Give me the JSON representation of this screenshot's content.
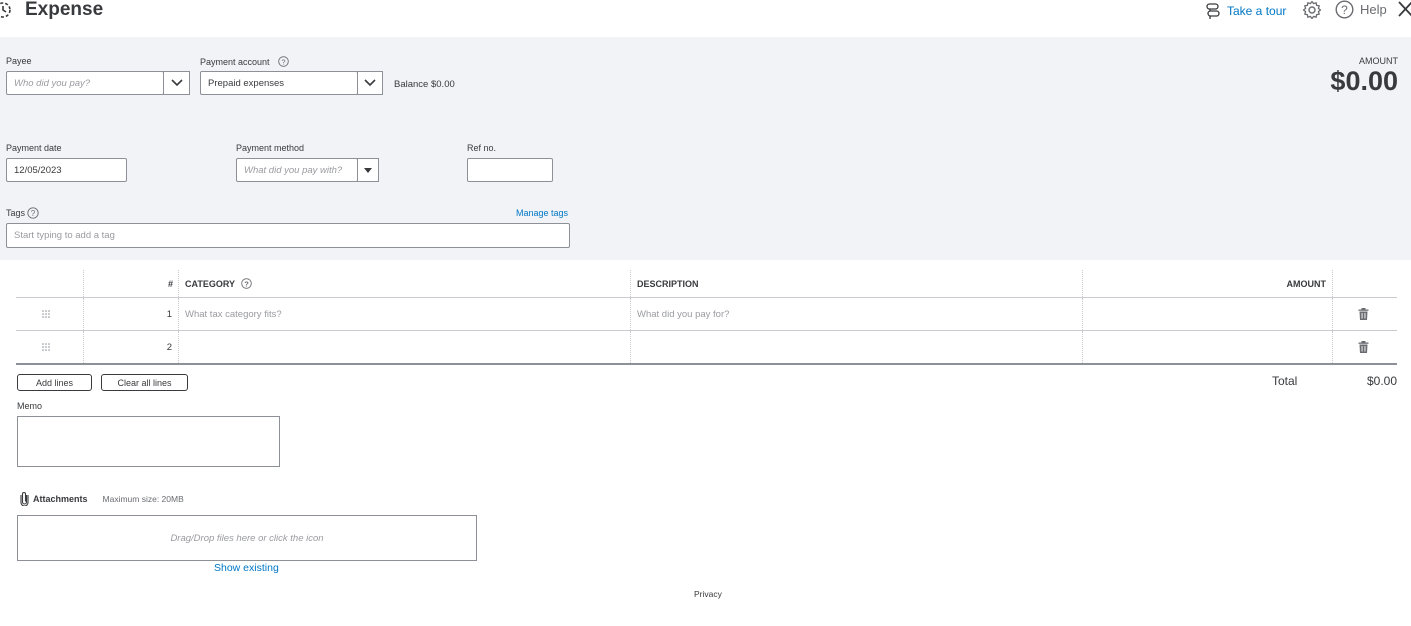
{
  "header": {
    "title": "Expense",
    "tour_label": "Take a tour",
    "help_label": "Help"
  },
  "form": {
    "payee_label": "Payee",
    "payee_placeholder": "Who did you pay?",
    "payment_account_label": "Payment account",
    "payment_account_value": "Prepaid expenses",
    "balance_label": "Balance",
    "balance_value": "$0.00",
    "amount_label": "AMOUNT",
    "amount_value": "$0.00",
    "payment_date_label": "Payment date",
    "payment_date_value": "12/05/2023",
    "payment_method_label": "Payment method",
    "payment_method_placeholder": "What did you pay with?",
    "ref_label": "Ref no.",
    "ref_value": "",
    "tags_label": "Tags",
    "manage_tags_label": "Manage tags",
    "tags_placeholder": "Start typing to add a tag"
  },
  "table": {
    "headers": {
      "num": "#",
      "category": "CATEGORY",
      "description": "DESCRIPTION",
      "amount": "AMOUNT"
    },
    "rows": [
      {
        "num": "1",
        "category_placeholder": "What tax category fits?",
        "description_placeholder": "What did you pay for?",
        "amount": ""
      },
      {
        "num": "2",
        "category_placeholder": "",
        "description_placeholder": "",
        "amount": ""
      }
    ],
    "add_lines_label": "Add lines",
    "clear_lines_label": "Clear all lines",
    "total_label": "Total",
    "total_value": "$0.00"
  },
  "memo": {
    "label": "Memo",
    "value": ""
  },
  "attachments": {
    "label": "Attachments",
    "max_size": "Maximum size: 20MB",
    "drop_text": "Drag/Drop files here or click the icon",
    "show_existing": "Show existing"
  },
  "footer": {
    "privacy": "Privacy"
  },
  "colors": {
    "accent": "#0077c5",
    "panel_bg": "#f1f3f6",
    "text": "#393a3d"
  }
}
